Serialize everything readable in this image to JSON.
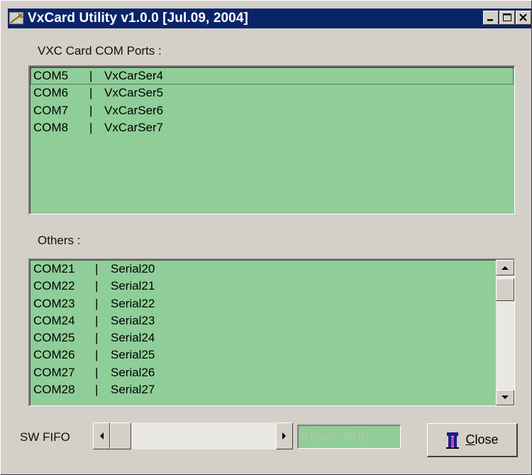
{
  "window": {
    "title": "VxCard Utility v1.0.0 [Jul.09, 2004]",
    "titlebar_color": "#0a246a",
    "buttons": [
      "minimize-icon",
      "maximize-icon",
      "close-icon"
    ]
  },
  "vxc_section": {
    "label": "VXC Card COM Ports :",
    "selected_index": 0,
    "rows": [
      {
        "port": "COM5",
        "sep": "|",
        "name": "VxCarSer4"
      },
      {
        "port": "COM6",
        "sep": "|",
        "name": "VxCarSer5"
      },
      {
        "port": "COM7",
        "sep": "|",
        "name": "VxCarSer6"
      },
      {
        "port": "COM8",
        "sep": "|",
        "name": "VxCarSer7"
      }
    ]
  },
  "others_section": {
    "label": "Others :",
    "rows": [
      {
        "port": "COM21",
        "sep": "|",
        "name": "Serial20"
      },
      {
        "port": "COM22",
        "sep": "|",
        "name": "Serial21"
      },
      {
        "port": "COM23",
        "sep": "|",
        "name": "Serial22"
      },
      {
        "port": "COM24",
        "sep": "|",
        "name": "Serial23"
      },
      {
        "port": "COM25",
        "sep": "|",
        "name": "Serial24"
      },
      {
        "port": "COM26",
        "sep": "|",
        "name": "Serial25"
      },
      {
        "port": "COM27",
        "sep": "|",
        "name": "Serial26"
      },
      {
        "port": "COM28",
        "sep": "|",
        "name": "Serial27"
      }
    ]
  },
  "fifo": {
    "label": "SW FIFO",
    "value_text": "0 (Auto, 4KB)"
  },
  "close_button": {
    "label_underlined": "C",
    "label_rest": "lose",
    "icon": "door-exit-icon"
  },
  "colors": {
    "list_background": "#8fce98",
    "dialog_background": "#d4d0c8"
  }
}
